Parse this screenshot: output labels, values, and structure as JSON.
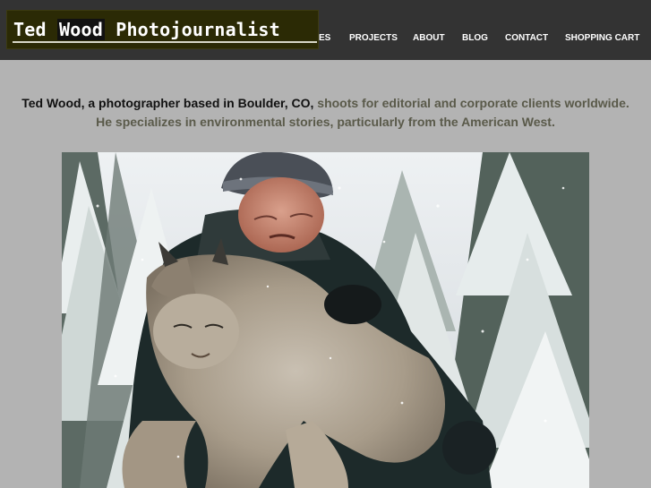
{
  "header": {
    "logo": {
      "part1": "Ted",
      "part2": "Wood",
      "part3": "Photojournalist"
    },
    "nav": [
      {
        "label": "ES"
      },
      {
        "label": "PROJECTS"
      },
      {
        "label": "ABOUT"
      },
      {
        "label": "BLOG"
      },
      {
        "label": "CONTACT"
      },
      {
        "label": "SHOPPING CART"
      }
    ]
  },
  "intro": {
    "lead": "Ted Wood, a photographer based in Boulder, CO,",
    "rest": "shoots for editorial and corporate clients worldwide. He specializes in environmental stories, particularly from the American West."
  },
  "photo": {
    "subject": "man holding lynx in snowy forest"
  },
  "colors": {
    "header_bg": "#333333",
    "page_bg": "#b3b3b3",
    "accent_text": "#5a5a4a"
  }
}
